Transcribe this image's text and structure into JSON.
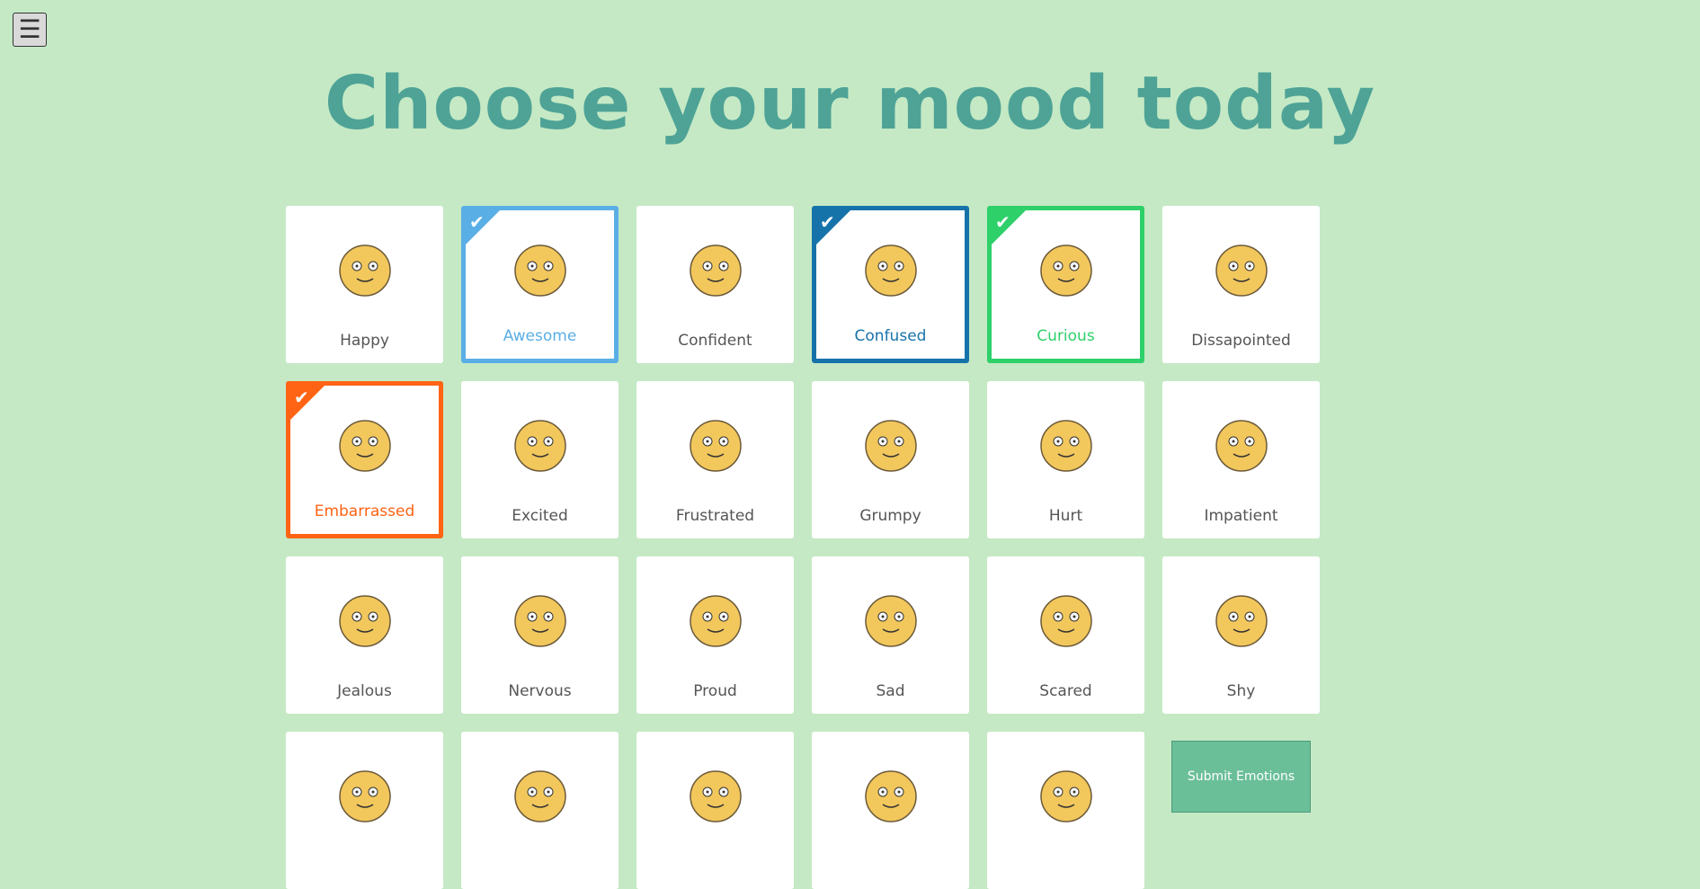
{
  "menu": {
    "icon": "hamburger-icon",
    "glyph": "☰"
  },
  "title": "Choose your mood today",
  "moods": [
    {
      "label": "Happy",
      "selected": false
    },
    {
      "label": "Awesome",
      "selected": true,
      "color": "#5aaee6"
    },
    {
      "label": "Confident",
      "selected": false
    },
    {
      "label": "Confused",
      "selected": true,
      "color": "#1673aa"
    },
    {
      "label": "Curious",
      "selected": true,
      "color": "#2ed06a"
    },
    {
      "label": "Dissapointed",
      "selected": false
    },
    {
      "label": "Embarrassed",
      "selected": true,
      "color": "#ff6314"
    },
    {
      "label": "Excited",
      "selected": false
    },
    {
      "label": "Frustrated",
      "selected": false
    },
    {
      "label": "Grumpy",
      "selected": false
    },
    {
      "label": "Hurt",
      "selected": false
    },
    {
      "label": "Impatient",
      "selected": false
    },
    {
      "label": "Jealous",
      "selected": false
    },
    {
      "label": "Nervous",
      "selected": false
    },
    {
      "label": "Proud",
      "selected": false
    },
    {
      "label": "Sad",
      "selected": false
    },
    {
      "label": "Scared",
      "selected": false
    },
    {
      "label": "Shy",
      "selected": false
    },
    {
      "label": "",
      "selected": false
    },
    {
      "label": "",
      "selected": false
    },
    {
      "label": "",
      "selected": false
    },
    {
      "label": "",
      "selected": false
    },
    {
      "label": "",
      "selected": false
    }
  ],
  "check_glyph": "✔",
  "submit_label": "Submit Emotions",
  "colors": {
    "background": "#c5e9c5",
    "title": "#4ea396",
    "face": "#f2c75c",
    "submit": "#6bbf98"
  }
}
